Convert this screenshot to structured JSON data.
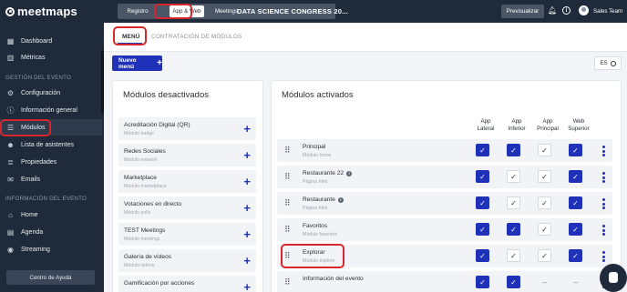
{
  "app": {
    "logo_text": "meetmaps",
    "event_title": "DATA SCIENCE CONGRESS 20...",
    "user_name": "Sales Team"
  },
  "topbar": {
    "tabs": [
      {
        "label": "Registro"
      },
      {
        "label": "App & Web",
        "active": true
      },
      {
        "label": "Meetings"
      }
    ],
    "preview_label": "Previsualizar"
  },
  "sidebar": {
    "items_top": [
      {
        "label": "Dashboard",
        "icon": "dashboard-icon"
      },
      {
        "label": "Métricas",
        "icon": "chart-icon"
      }
    ],
    "section_event": "GESTIÓN DEL EVENTO",
    "items_event": [
      {
        "label": "Configuración",
        "icon": "gear-icon"
      },
      {
        "label": "Información general",
        "icon": "info-icon"
      },
      {
        "label": "Módulos",
        "icon": "list-icon",
        "active": true
      },
      {
        "label": "Lista de asistentes",
        "icon": "people-icon"
      },
      {
        "label": "Propiedades",
        "icon": "properties-icon"
      },
      {
        "label": "Emails",
        "icon": "mail-icon"
      }
    ],
    "section_info": "INFORMACIÓN DEL EVENTO",
    "items_info": [
      {
        "label": "Home",
        "icon": "home-icon"
      },
      {
        "label": "Agenda",
        "icon": "calendar-icon"
      },
      {
        "label": "Streaming",
        "icon": "stream-icon"
      }
    ],
    "help_label": "Centro de Ayuda"
  },
  "subtabs": [
    {
      "label": "MENÚ",
      "active": true
    },
    {
      "label": "CONTRATACIÓN DE MÓDULOS"
    }
  ],
  "new_menu_label": "Nuevo menú",
  "language": "ES",
  "disabled_panel": {
    "title": "Módulos desactivados",
    "items": [
      {
        "name": "Acreditación Digital (QR)",
        "sub": "Módulo badge"
      },
      {
        "name": "Redes Sociales",
        "sub": "Módulo network"
      },
      {
        "name": "Marketplace",
        "sub": "Módulo marketplace"
      },
      {
        "name": "Votaciones en directo",
        "sub": "Módulo polls"
      },
      {
        "name": "TEST Meetings",
        "sub": "Módulo meetings"
      },
      {
        "name": "Galería de vídeos",
        "sub": "Módulo videos"
      },
      {
        "name": "Gamificación por acciones",
        "sub": ""
      }
    ]
  },
  "active_panel": {
    "title": "Módulos activados",
    "columns": [
      {
        "line1": "App",
        "line2": "Lateral"
      },
      {
        "line1": "App",
        "line2": "Inferior"
      },
      {
        "line1": "App",
        "line2": "Principal"
      },
      {
        "line1": "Web",
        "line2": "Superior"
      }
    ],
    "items": [
      {
        "name": "Principal",
        "sub": "Módulo home",
        "info": false,
        "checks": [
          "on",
          "on",
          "off",
          "on"
        ]
      },
      {
        "name": "Restaurante 22",
        "sub": "Página html",
        "info": true,
        "checks": [
          "on",
          "off",
          "off",
          "on"
        ]
      },
      {
        "name": "Restaurante",
        "sub": "Página html",
        "info": true,
        "checks": [
          "on",
          "off",
          "off",
          "on"
        ]
      },
      {
        "name": "Favoritos",
        "sub": "Módulo favorites",
        "info": false,
        "checks": [
          "on",
          "on",
          "off",
          "on"
        ]
      },
      {
        "name": "Explorar",
        "sub": "Módulo explore",
        "info": false,
        "checks": [
          "on",
          "off",
          "off",
          "on"
        ]
      },
      {
        "name": "Información del evento",
        "sub": "",
        "info": false,
        "checks": [
          "on",
          "on",
          "dash",
          "dash"
        ]
      }
    ]
  }
}
